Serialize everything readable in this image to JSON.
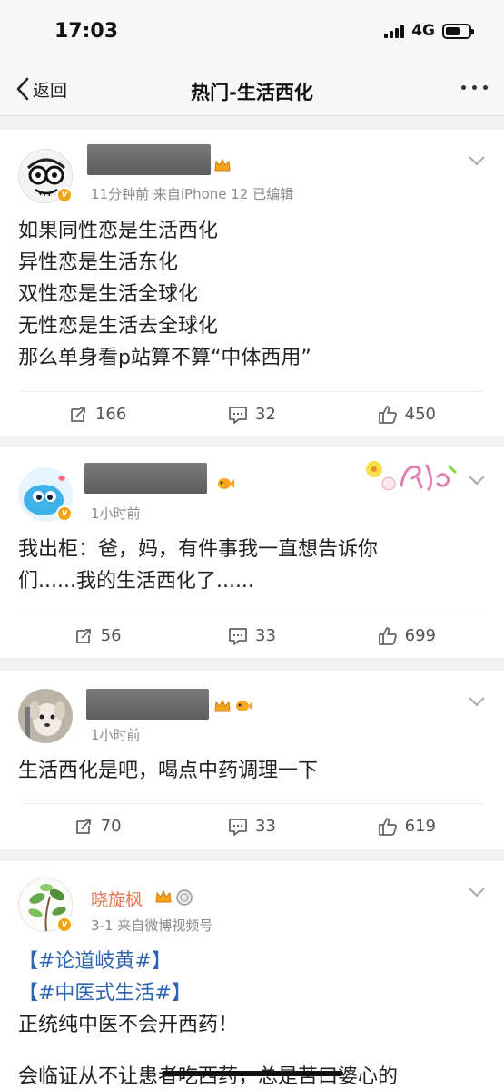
{
  "status_bar": {
    "time": "17:03",
    "network": "4G"
  },
  "nav": {
    "back_label": "返回",
    "title": "热门-生活西化"
  },
  "posts": [
    {
      "meta": "11分钟前  来自iPhone 12  已编辑",
      "lines": [
        "如果同性恋是生活西化",
        "异性恋是生活东化",
        "双性恋是生活全球化",
        "无性恋是生活去全球化",
        "那么单身看p站算不算“中体西用”"
      ],
      "reposts": "166",
      "comments": "32",
      "likes": "450"
    },
    {
      "meta": "1小时前",
      "lines": [
        "我出柜：爸，妈，有件事我一直想告诉你",
        "们......我的生活西化了......"
      ],
      "reposts": "56",
      "comments": "33",
      "likes": "699"
    },
    {
      "meta": "1小时前",
      "lines": [
        "生活西化是吧，喝点中药调理一下"
      ],
      "reposts": "70",
      "comments": "33",
      "likes": "619"
    },
    {
      "name": "晓旋枫",
      "meta": "3-1  来自微博视频号",
      "tags": [
        "【#论道岐黄#】",
        "【#中医式生活#】"
      ],
      "lines": [
        "正统纯中医不会开西药！",
        "会临证从不让患者吃西药，总是苦口婆心的"
      ]
    }
  ]
}
